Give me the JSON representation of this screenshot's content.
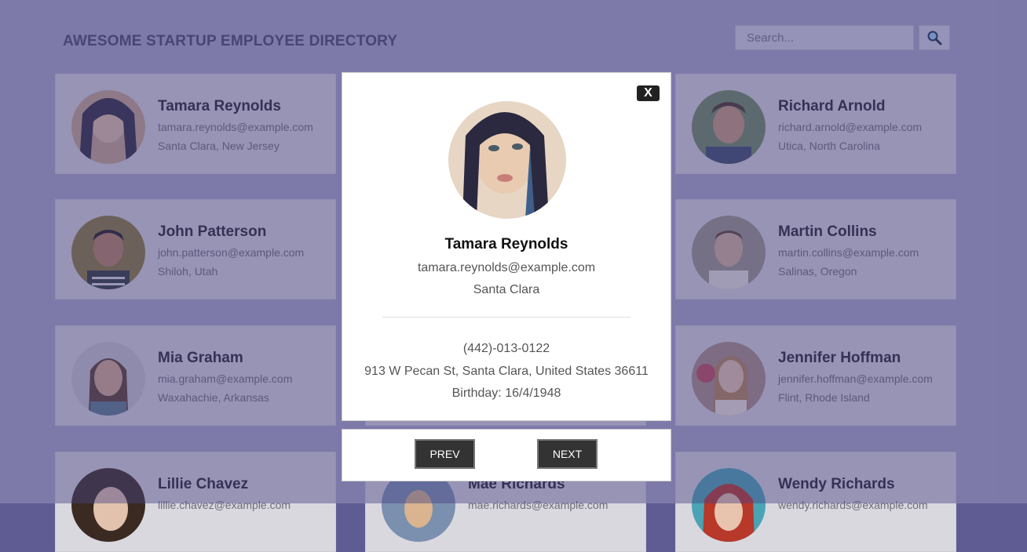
{
  "header": {
    "title": "AWESOME STARTUP EMPLOYEE DIRECTORY",
    "search_placeholder": "Search...",
    "search_icon": "magnifier-icon"
  },
  "cards": [
    {
      "name": "Tamara Reynolds",
      "email": "tamara.reynolds@example.com",
      "city": "Santa Clara, New Jersey"
    },
    {
      "name": "Richard Arnold",
      "email": "richard.arnold@example.com",
      "city": "Utica, North Carolina"
    },
    {
      "name": "John Patterson",
      "email": "john.patterson@example.com",
      "city": "Shiloh, Utah"
    },
    {
      "name": "Martin Collins",
      "email": "martin.collins@example.com",
      "city": "Salinas, Oregon"
    },
    {
      "name": "Mia Graham",
      "email": "mia.graham@example.com",
      "city": "Waxahachie, Arkansas"
    },
    {
      "name": "Jennifer Hoffman",
      "email": "jennifer.hoffman@example.com",
      "city": "Flint, Rhode Island"
    },
    {
      "name": "Lillie Chavez",
      "email": "lillie.chavez@example.com",
      "city": ""
    },
    {
      "name": "Mae Richards",
      "email": "mae.richards@example.com",
      "city": ""
    },
    {
      "name": "Wendy Richards",
      "email": "wendy.richards@example.com",
      "city": ""
    }
  ],
  "modal": {
    "close_label": "X",
    "name": "Tamara Reynolds",
    "email": "tamara.reynolds@example.com",
    "city": "Santa Clara",
    "phone": "(442)-013-0122",
    "address": "913 W Pecan St, Santa Clara, United States 36611",
    "birthday": "Birthday: 16/4/1948"
  },
  "nav": {
    "prev_label": "PREV",
    "next_label": "NEXT"
  },
  "colors": {
    "background": "#5f5c94",
    "card": "#d9d8df",
    "modal": "#ffffff",
    "button": "#333333"
  }
}
